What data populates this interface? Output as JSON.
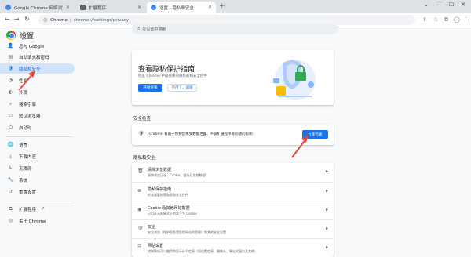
{
  "tabs": [
    {
      "title": "Google Chrome 网络浏览器",
      "fav_color": "#4285f4"
    },
    {
      "title": "扩展程序",
      "fav_color": "#5f6368"
    },
    {
      "title": "设置 - 隐私和安全",
      "fav_color": "#4285f4"
    }
  ],
  "newtab": "+",
  "toolbar": {
    "back": "←",
    "forward": "→",
    "reload": "↻",
    "site": "Chrome",
    "separator": "|",
    "url": "chrome://settings/privacy"
  },
  "sidebar": {
    "title": "设置",
    "items": [
      {
        "label": "您与 Google",
        "icon": "person-icon",
        "glyph": "👤"
      },
      {
        "label": "自动填充和密码",
        "icon": "autofill-icon",
        "glyph": "▤"
      },
      {
        "label": "隐私和安全",
        "icon": "shield-icon",
        "glyph": "🛡"
      },
      {
        "label": "性能",
        "icon": "speed-icon",
        "glyph": "◔"
      },
      {
        "label": "外观",
        "icon": "palette-icon",
        "glyph": "◐"
      },
      {
        "label": "搜索引擎",
        "icon": "search-icon",
        "glyph": "⌕"
      },
      {
        "label": "默认浏览器",
        "icon": "browser-icon",
        "glyph": "▭"
      },
      {
        "label": "启动时",
        "icon": "power-icon",
        "glyph": "⏻"
      },
      {
        "label": "语言",
        "icon": "globe-icon",
        "glyph": "🌐"
      },
      {
        "label": "下载内容",
        "icon": "download-icon",
        "glyph": "⤓"
      },
      {
        "label": "无障碍",
        "icon": "accessibility-icon",
        "glyph": "♿"
      },
      {
        "label": "系统",
        "icon": "wrench-icon",
        "glyph": "🔧"
      },
      {
        "label": "重置设置",
        "icon": "reset-icon",
        "glyph": "↺"
      },
      {
        "label": "扩展程序",
        "icon": "puzzle-icon",
        "glyph": "⧉"
      },
      {
        "label": "关于 Chrome",
        "icon": "chrome-icon",
        "glyph": "◎"
      }
    ]
  },
  "search_placeholder": "在设置中搜索",
  "guide": {
    "title": "查看隐私保护指南",
    "desc": "检查 Chrome 中最重要的隐私权和安全控件",
    "start": "开始查看",
    "dismiss": "不用了，谢谢"
  },
  "safety": {
    "section": "安全检查",
    "text": "Chrome 有助于保护您免受数据泄露、不良扩展程序等问题的影响",
    "button": "立即检查"
  },
  "privacy": {
    "section": "隐私和安全",
    "rows": [
      {
        "title": "清除浏览数据",
        "sub": "清除浏览记录、Cookie、缓存及其他数据",
        "icon": "trash-icon",
        "glyph": "🗑"
      },
      {
        "title": "隐私保护指南",
        "sub": "检查重要的隐私权和安全控件",
        "icon": "guide-icon",
        "glyph": "⊕"
      },
      {
        "title": "Cookie 及其他网站数据",
        "sub": "已阻止无痕模式下的第三方 Cookie",
        "icon": "cookie-icon",
        "glyph": "◉"
      },
      {
        "title": "安全",
        "sub": "安全浏览（保护您免受危险网站的侵害）和其他安全设置",
        "icon": "security-icon",
        "glyph": "🛡"
      },
      {
        "title": "网站设置",
        "sub": "控制网站可以使用和显示什么信息（如位置信息、摄像头、弹出式窗口及其他）",
        "icon": "sliders-icon",
        "glyph": "☰"
      }
    ]
  },
  "colors": {
    "accent": "#1a73e8",
    "selected_bg": "#d2e3fc",
    "arrow": "#e8453c"
  }
}
